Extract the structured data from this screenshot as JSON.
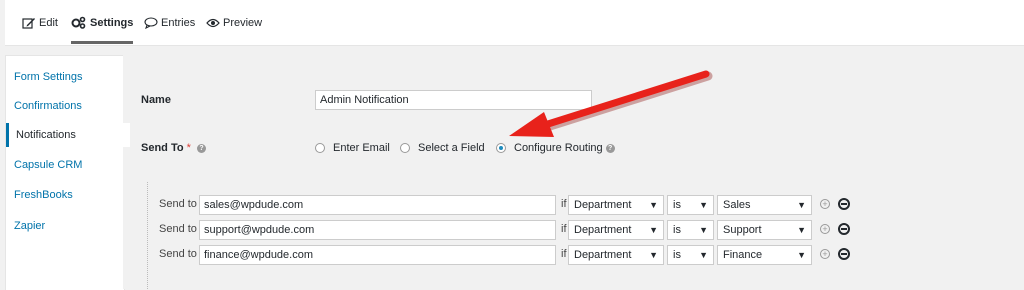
{
  "toolbar": {
    "tabs": [
      {
        "label": "Edit",
        "icon": "edit-icon"
      },
      {
        "label": "Settings",
        "icon": "gears-icon",
        "active": true
      },
      {
        "label": "Entries",
        "icon": "comment-icon"
      },
      {
        "label": "Preview",
        "icon": "eye-icon"
      }
    ]
  },
  "sidebar": {
    "items": [
      {
        "label": "Form Settings"
      },
      {
        "label": "Confirmations"
      },
      {
        "label": "Notifications",
        "active": true
      },
      {
        "label": "Capsule CRM"
      },
      {
        "label": "FreshBooks"
      },
      {
        "label": "Zapier"
      }
    ]
  },
  "form": {
    "name_label": "Name",
    "name_value": "Admin Notification",
    "send_to_label": "Send To",
    "required_mark": "*",
    "help_glyph": "?",
    "options": [
      {
        "label": "Enter Email",
        "selected": false
      },
      {
        "label": "Select a Field",
        "selected": false
      },
      {
        "label": "Configure Routing",
        "selected": true
      }
    ]
  },
  "routing": {
    "send_to_label": "Send to",
    "if_label": "if",
    "caret": "▼",
    "rules": [
      {
        "email": "sales@wpdude.com",
        "field": "Department",
        "operator": "is",
        "value": "Sales"
      },
      {
        "email": "support@wpdude.com",
        "field": "Department",
        "operator": "is",
        "value": "Support"
      },
      {
        "email": "finance@wpdude.com",
        "field": "Department",
        "operator": "is",
        "value": "Finance"
      }
    ]
  },
  "colors": {
    "accent": "#0073aa",
    "arrow": "#e8221b"
  }
}
